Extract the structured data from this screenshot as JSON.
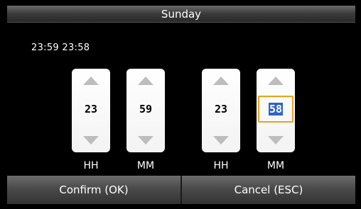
{
  "title": "Sunday",
  "range_text": "23:59  23:58",
  "spinners": [
    {
      "value": "23",
      "unit": "HH",
      "active": false
    },
    {
      "value": "59",
      "unit": "MM",
      "active": false
    },
    {
      "value": "23",
      "unit": "HH",
      "active": false
    },
    {
      "value": "58",
      "unit": "MM",
      "active": true
    }
  ],
  "buttons": {
    "confirm": "Confirm (OK)",
    "cancel": "Cancel (ESC)"
  },
  "colors": {
    "selection": "#2f63c8",
    "focus_border": "#e8a21c"
  }
}
